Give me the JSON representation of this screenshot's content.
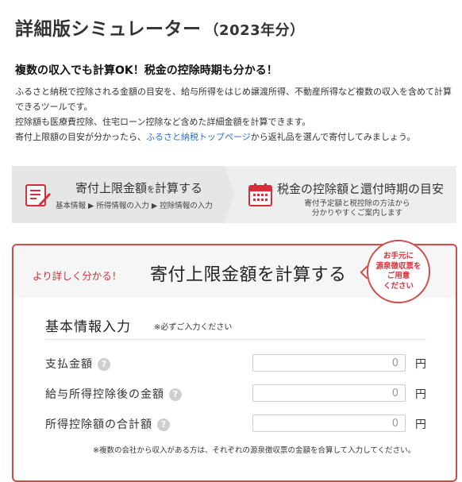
{
  "page": {
    "title": "詳細版シミュレーター",
    "title_year": "（2023年分）",
    "headline": "複数の収入でも計算OK！税金の控除時期も分かる！",
    "intro_line1": "ふるさと納税で控除される金額の目安を、給与所得をはじめ譲渡所得、不動産所得など複数の収入を含めて計算できるツールです。",
    "intro_line2": "控除額も医療費控除、住宅ローン控除など含めた詳細金額を計算できます。",
    "intro_line3_before": "寄付上限額の目安が分かったら、",
    "intro_link": "ふるさと納税トップページ",
    "intro_line3_after": "から返礼品を選んで寄付してみましょう。"
  },
  "steps": {
    "step1_title_a": "寄付上限金額",
    "step1_title_small": "を",
    "step1_title_b": "計算する",
    "step1_sub": "基本情報 ▶ 所得情報の入力 ▶ 控除情報の入力",
    "step1_icon": "calculator-document-icon",
    "step2_title": "税金の控除額と還付時期の目安",
    "step2_sub_line1": "寄付予定額と税控除の方法から",
    "step2_sub_line2": "分かりやすくご案内します",
    "step2_icon": "calendar-icon"
  },
  "calculator": {
    "lead": "より詳しく分かる！",
    "title": "寄付上限金額を計算する",
    "bubble_line1": "お手元に",
    "bubble_line2": "源泉徴収票を",
    "bubble_line3": "ご用意",
    "bubble_line4": "ください",
    "section_title": "基本情報入力",
    "section_note": "※必ずご入力ください",
    "help_icon_glyph": "?",
    "rows": [
      {
        "label": "支払金額",
        "value": "0",
        "unit": "円"
      },
      {
        "label": "給与所得控除後の金額",
        "value": "0",
        "unit": "円"
      },
      {
        "label": "所得控除額の合計額",
        "value": "0",
        "unit": "円"
      }
    ],
    "footnote": "※複数の会社から収入がある方は、それぞれの源泉徴収票の金額を合算して入力してください。"
  },
  "colors": {
    "accent_red": "#d5303a",
    "border_red": "#d24a4a",
    "link_blue": "#2a6fd0",
    "step_bg": "#eeeeee"
  }
}
